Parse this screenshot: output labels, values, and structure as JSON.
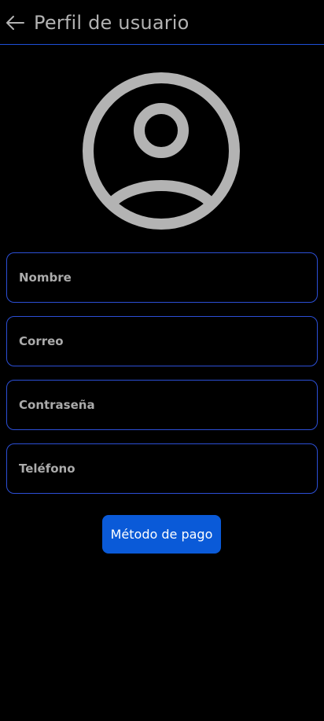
{
  "header": {
    "back_icon": "arrow-left-icon",
    "title": "Perfil de usuario"
  },
  "avatar": {
    "icon": "account-circle-icon",
    "color": "#b3b3b3"
  },
  "form": {
    "fields": [
      {
        "name": "nombre",
        "value": "",
        "placeholder": "Nombre"
      },
      {
        "name": "correo",
        "value": "",
        "placeholder": "Correo"
      },
      {
        "name": "contrasena",
        "value": "",
        "placeholder": "Contraseña"
      },
      {
        "name": "telefono",
        "value": "",
        "placeholder": "Teléfono"
      }
    ]
  },
  "actions": {
    "payment_label": "Método de pago"
  },
  "colors": {
    "background": "#000000",
    "accent_border": "#2c4fd6",
    "button": "#0a5ad8",
    "text_muted": "#b0b0b0"
  }
}
